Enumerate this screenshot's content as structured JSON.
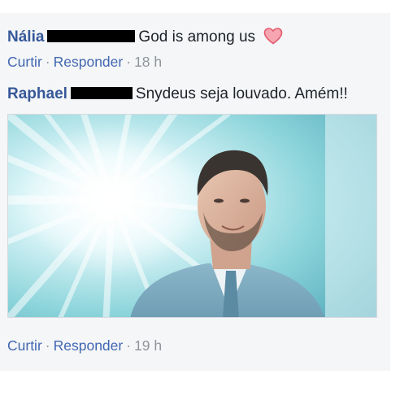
{
  "comments": [
    {
      "author": "Nália",
      "text": "God is among us",
      "reaction_icon": "heart-icon",
      "reaction_color": "#f25268",
      "actions": {
        "like": "Curtir",
        "reply": "Responder",
        "time": "18 h"
      }
    },
    {
      "author": "Raphael",
      "text": "Snydeus seja louvado. Amém!!",
      "image": "man-in-light-rays-photo",
      "actions": {
        "like": "Curtir",
        "reply": "Responder",
        "time": "19 h"
      }
    }
  ],
  "separator": "·",
  "colors": {
    "author": "#365899",
    "link": "#4267b2",
    "meta": "#90949c",
    "panel_bg": "#f5f6f7"
  }
}
